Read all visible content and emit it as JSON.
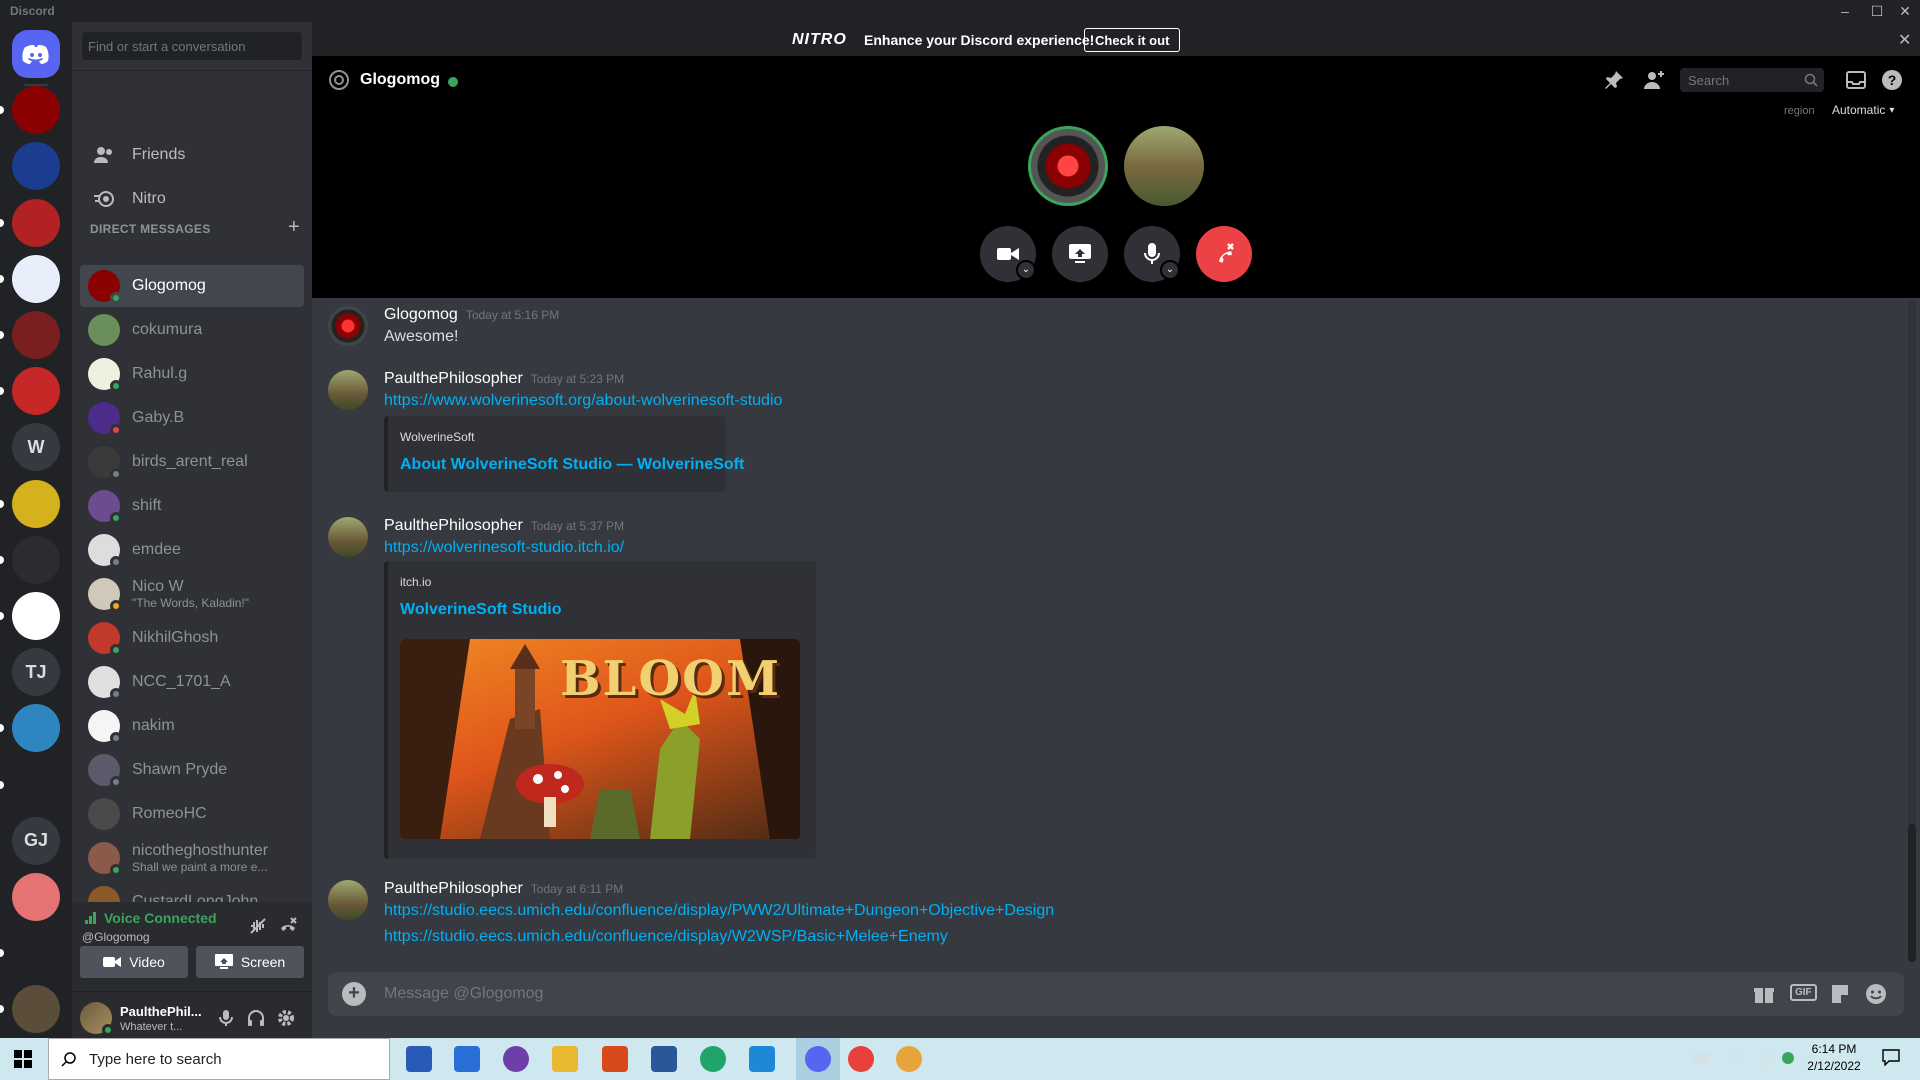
{
  "window": {
    "title": "Discord"
  },
  "nitro_banner": {
    "logo": "NITRO",
    "text": "Enhance your Discord experience!",
    "button": "Check it out"
  },
  "guilds": [
    {
      "initials": "",
      "color": "#5865f2",
      "icon": "discord-home-icon"
    },
    {
      "initials": "",
      "color": "#8b0000",
      "icon": "red-eye-server"
    },
    {
      "initials": "",
      "color": "#1a3d8f",
      "icon": "yin-yang-server"
    },
    {
      "initials": "",
      "color": "#b22222",
      "icon": "red-box-server"
    },
    {
      "initials": "",
      "color": "#e8eefa",
      "icon": "blue-pattern-server"
    },
    {
      "initials": "",
      "color": "#7a1f1f",
      "icon": "red-grid-server"
    },
    {
      "initials": "",
      "color": "#c62828",
      "icon": "avatar-server"
    },
    {
      "initials": "W",
      "color": "#36393f",
      "icon": ""
    },
    {
      "initials": "",
      "color": "#d4b11d",
      "icon": "yellow-x-server"
    },
    {
      "initials": "",
      "color": "#2b2d31",
      "icon": "emblem-server"
    },
    {
      "initials": "",
      "color": "#ffffff",
      "icon": "pink-f-server"
    },
    {
      "initials": "TJ",
      "color": "#36393f",
      "icon": ""
    },
    {
      "initials": "",
      "color": "#2e86c1",
      "icon": "blue-robot-server"
    },
    {
      "initials": "",
      "color": "#202225",
      "icon": "white-figure-server"
    },
    {
      "initials": "GJ",
      "color": "#36393f",
      "icon": ""
    },
    {
      "initials": "",
      "color": "#e57373",
      "icon": "orange-bus-server"
    },
    {
      "initials": "",
      "color": "#202225",
      "icon": "m-logo-server"
    },
    {
      "initials": "",
      "color": "#5a4e3a",
      "icon": "bloom-server"
    }
  ],
  "sidebar": {
    "search_placeholder": "Find or start a conversation",
    "friends": "Friends",
    "nitro": "Nitro",
    "dm_header": "DIRECT MESSAGES",
    "dms": [
      {
        "name": "Glogomog",
        "sub": "",
        "color": "#8b0000",
        "status": "#3ba55d",
        "active": true
      },
      {
        "name": "cokumura",
        "sub": "",
        "color": "#6a8f5a",
        "status": "",
        "active": false
      },
      {
        "name": "Rahul.g",
        "sub": "",
        "color": "#f0f0e0",
        "status": "#3ba55d",
        "active": false
      },
      {
        "name": "Gaby.B",
        "sub": "",
        "color": "#4b2c8a",
        "status": "#ed4245",
        "active": false
      },
      {
        "name": "birds_arent_real",
        "sub": "",
        "color": "#3a3a3a",
        "status": "#747f8d",
        "active": false
      },
      {
        "name": "shift",
        "sub": "",
        "color": "#6c4b8f",
        "status": "#3ba55d",
        "active": false
      },
      {
        "name": "emdee",
        "sub": "",
        "color": "#ddd",
        "status": "#747f8d",
        "active": false
      },
      {
        "name": "Nico W",
        "sub": "\"The Words, Kaladin!\"",
        "color": "#d0c8b8",
        "status": "#faa61a",
        "active": false
      },
      {
        "name": "NikhilGhosh",
        "sub": "",
        "color": "#c0392b",
        "status": "#3ba55d",
        "active": false
      },
      {
        "name": "NCC_1701_A",
        "sub": "",
        "color": "#e0e0e0",
        "status": "#747f8d",
        "active": false
      },
      {
        "name": "nakim",
        "sub": "",
        "color": "#f5f5f5",
        "status": "#747f8d",
        "active": false
      },
      {
        "name": "Shawn Pryde",
        "sub": "",
        "color": "#5a5a6a",
        "status": "#747f8d",
        "active": false
      },
      {
        "name": "RomeoHC",
        "sub": "",
        "color": "#4a4a4a",
        "status": "",
        "active": false
      },
      {
        "name": "nicotheghosthunter",
        "sub": "Shall we paint a more e...",
        "color": "#8a5a4a",
        "status": "#3ba55d",
        "active": false
      },
      {
        "name": "CustardLongJohn",
        "sub": "",
        "color": "#8b5a2b",
        "status": "",
        "active": false
      }
    ]
  },
  "voice": {
    "status": "Voice Connected",
    "channel": "@Glogomog",
    "video": "Video",
    "screen": "Screen"
  },
  "user": {
    "name": "PaulthePhil...",
    "status": "Whatever t..."
  },
  "header": {
    "channel": "Glogomog",
    "search_placeholder": "Search",
    "region_label": "region",
    "region_value": "Automatic"
  },
  "messages": [
    {
      "author": "Glogomog",
      "time": "Today at 5:16 PM",
      "text": "Awesome!"
    },
    {
      "author": "PaulthePhilosopher",
      "time": "Today at 5:23 PM",
      "link": "https://www.wolverinesoft.org/about-wolverinesoft-studio",
      "embed_provider": "WolverineSoft",
      "embed_title": "About WolverineSoft Studio — WolverineSoft"
    },
    {
      "author": "PaulthePhilosopher",
      "time": "Today at 5:37 PM",
      "link": "https://wolverinesoft-studio.itch.io/",
      "embed_provider": "itch.io",
      "embed_title": "WolverineSoft Studio",
      "embed_image_text": "BLOOM"
    },
    {
      "author": "PaulthePhilosopher",
      "time": "Today at 6:11 PM",
      "link": "https://studio.eecs.umich.edu/confluence/display/PWW2/Ultimate+Dungeon+Objective+Design",
      "link2": "https://studio.eecs.umich.edu/confluence/display/W2WSP/Basic+Melee+Enemy"
    }
  ],
  "composer": {
    "placeholder": "Message @Glogomog"
  },
  "taskbar": {
    "search_placeholder": "Type here to search",
    "time": "6:14 PM",
    "date": "2/12/2022"
  }
}
